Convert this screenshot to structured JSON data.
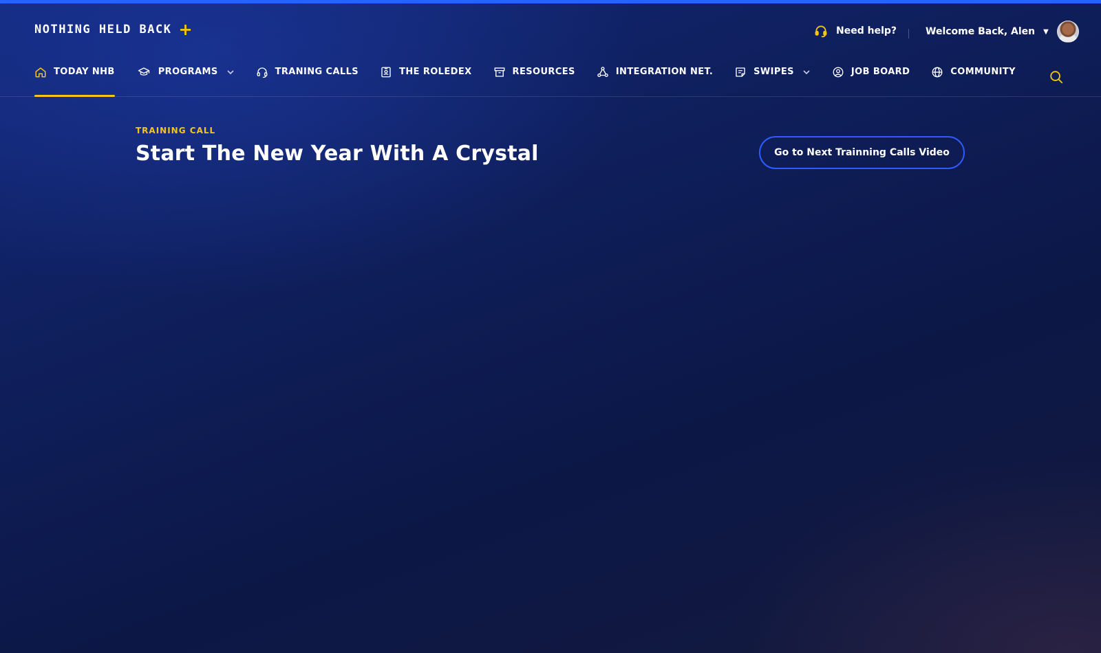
{
  "brand": {
    "name": "NOTHING HELD BACK",
    "plus": "+"
  },
  "header": {
    "help_label": "Need help?",
    "welcome": "Welcome Back, Alen"
  },
  "nav": {
    "items": [
      {
        "label": "TODAY NHB",
        "icon": "home-icon",
        "active": true
      },
      {
        "label": "PROGRAMS",
        "icon": "graduation-cap-icon",
        "dropdown": true
      },
      {
        "label": "TRANING CALLS",
        "icon": "headset-icon"
      },
      {
        "label": "THE ROLEDEX",
        "icon": "contact-card-icon"
      },
      {
        "label": "RESOURCES",
        "icon": "archive-box-icon"
      },
      {
        "label": "INTEGRATION NET.",
        "icon": "network-icon"
      },
      {
        "label": "SWIPES",
        "icon": "note-icon",
        "dropdown": true
      },
      {
        "label": "JOB BOARD",
        "icon": "user-circle-icon"
      },
      {
        "label": "COMMUNITY",
        "icon": "globe-icon"
      }
    ]
  },
  "hero": {
    "kicker": "TRAINING CALL",
    "title": "Start The New Year With A Crystal",
    "next_button": "Go to Next Trainning Calls Video"
  },
  "colors": {
    "accent": "#f5c518",
    "primary_blue": "#2563ff",
    "background": "#0f1f5c"
  }
}
